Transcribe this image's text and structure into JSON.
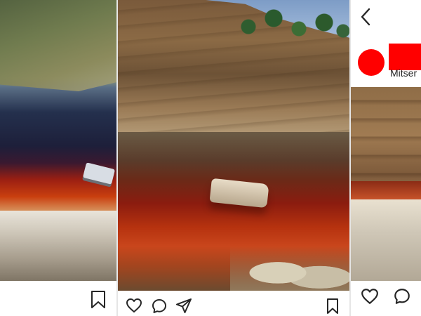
{
  "panels": {
    "left": {
      "icons": [
        "bookmark-icon"
      ]
    },
    "center": {
      "icons": [
        "heart-icon",
        "comment-icon",
        "share-icon",
        "bookmark-icon"
      ]
    },
    "right": {
      "header": {
        "back_icon": "chevron-left-icon",
        "username": "Mitser"
      },
      "icons": [
        "heart-icon",
        "comment-icon"
      ]
    }
  },
  "colors": {
    "redaction": "#ff0000",
    "icon_stroke": "#262626",
    "divider": "#e6e6e6"
  }
}
